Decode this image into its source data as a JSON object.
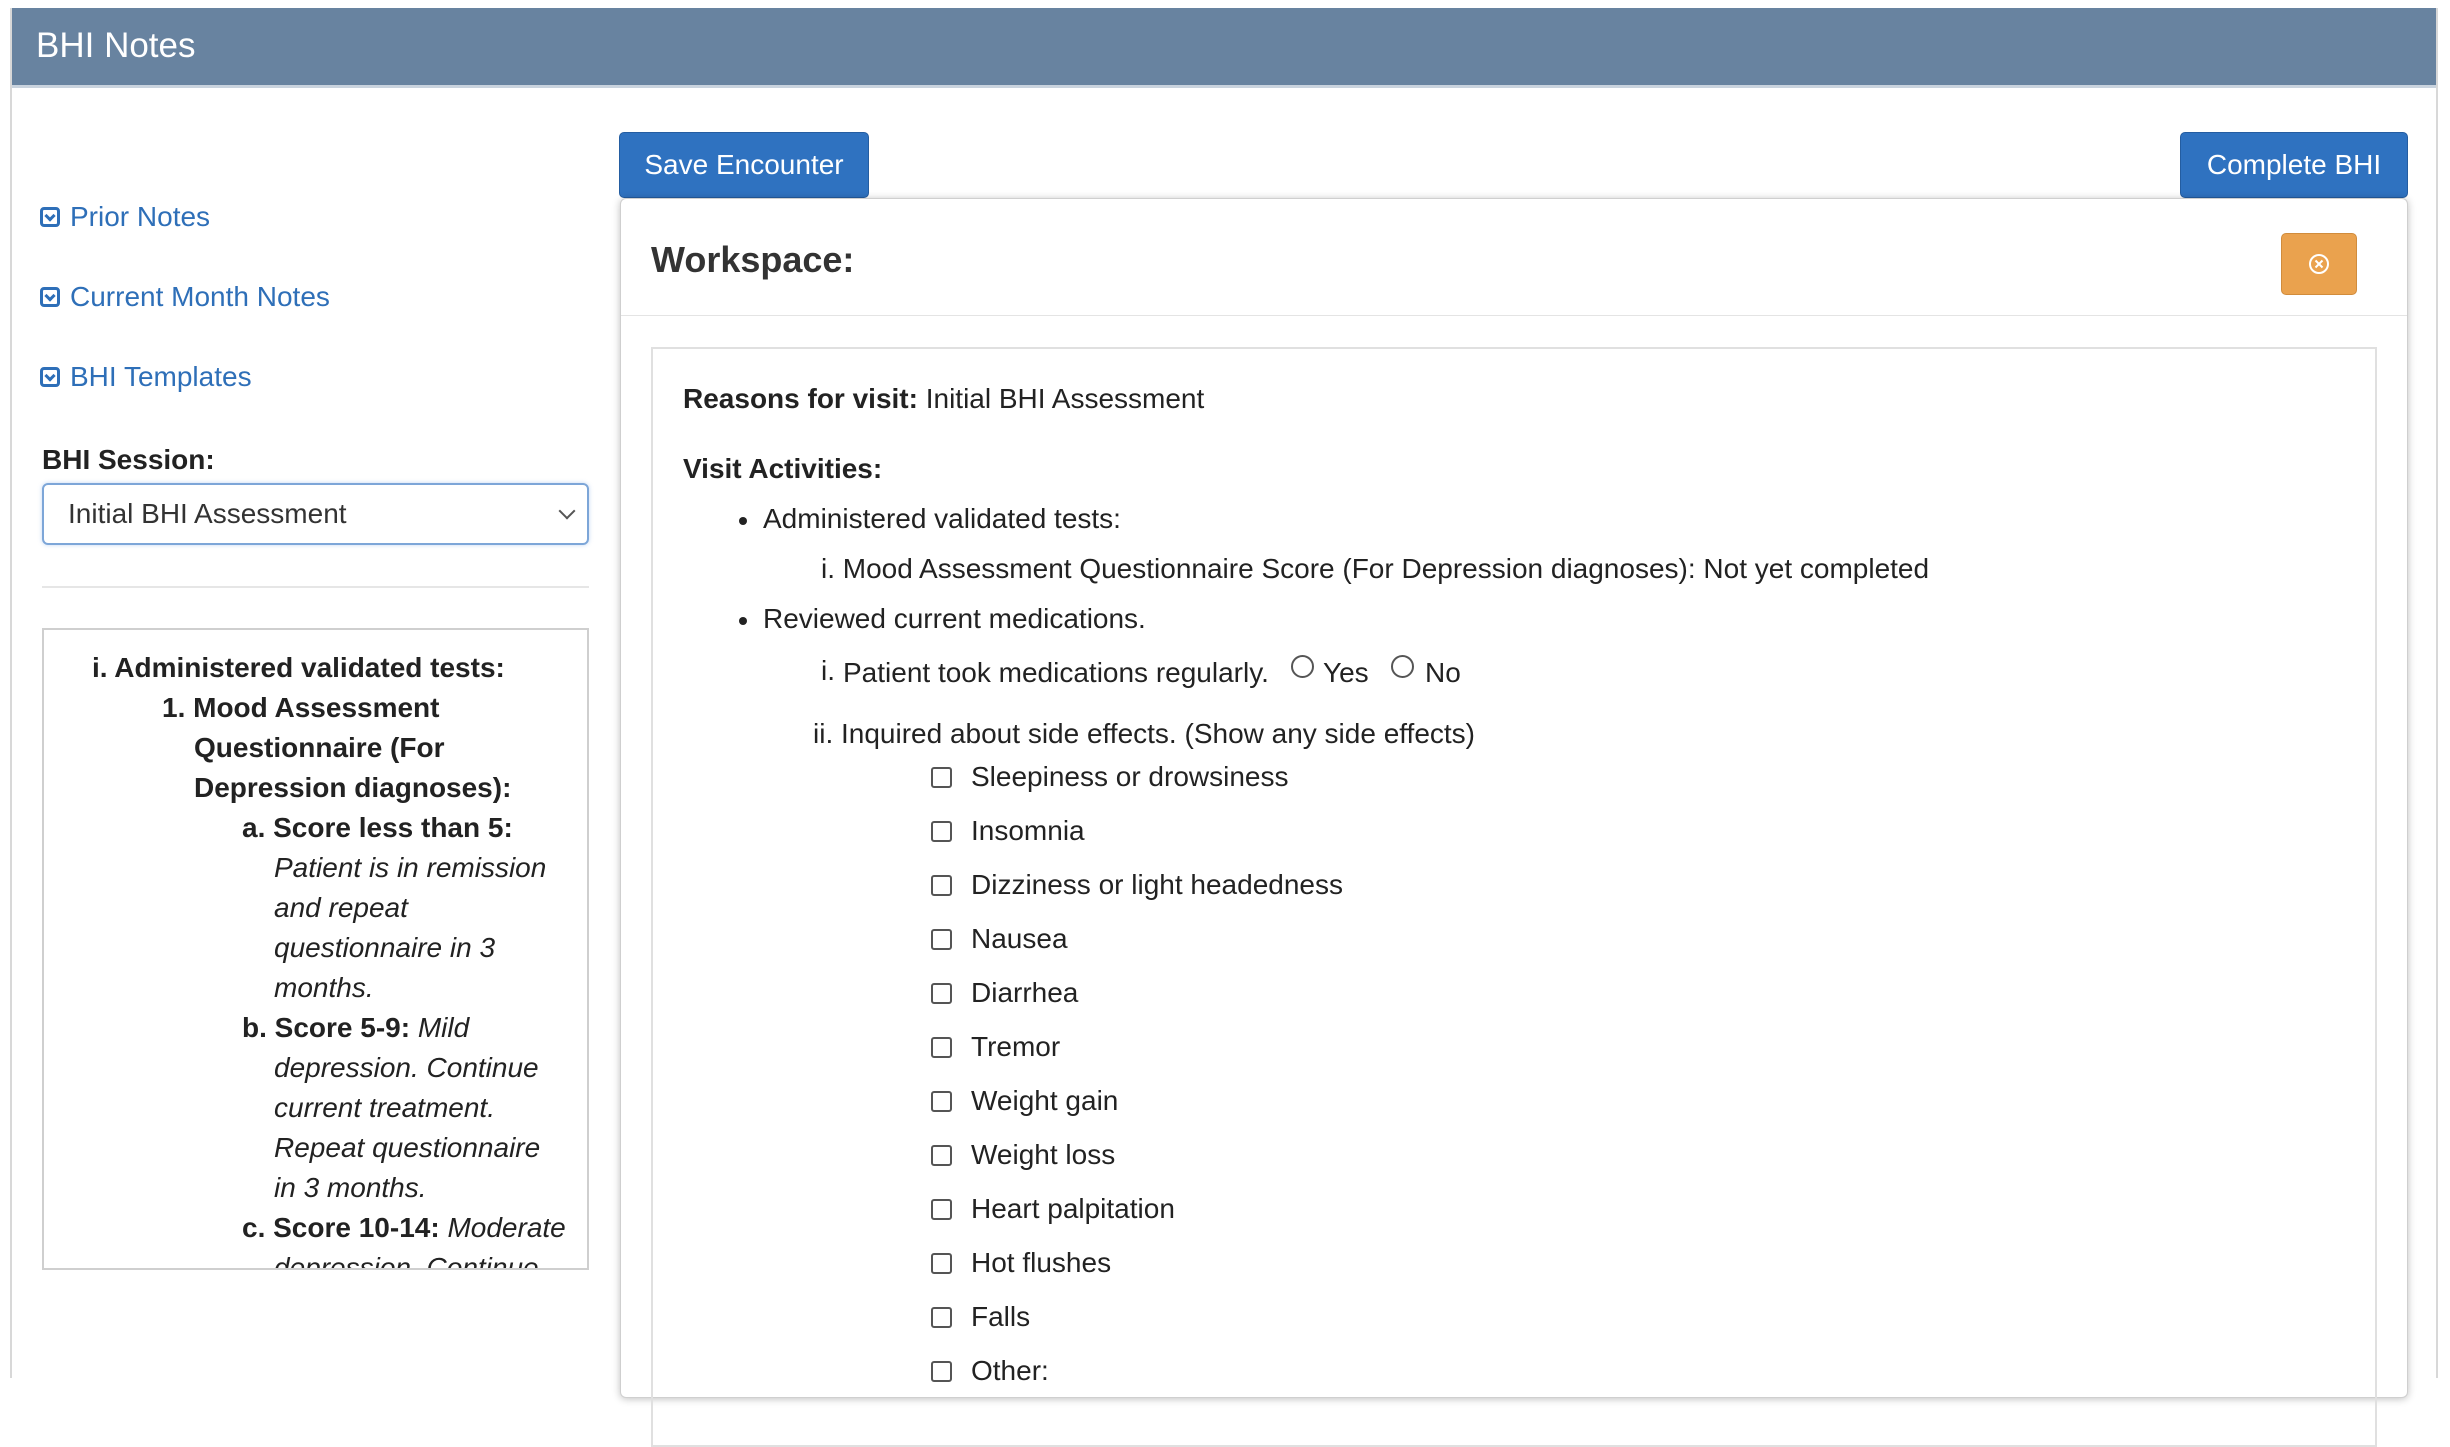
{
  "app": {
    "title": "BHI Notes"
  },
  "toolbar": {
    "save_label": "Save Encounter",
    "complete_label": "Complete BHI"
  },
  "sidebar": {
    "links": [
      {
        "label": "Prior Notes",
        "icon": "chevron-down-square-icon"
      },
      {
        "label": "Current Month Notes",
        "icon": "chevron-down-square-icon"
      },
      {
        "label": "BHI Templates",
        "icon": "chevron-down-square-icon"
      }
    ],
    "session_label": "BHI Session:",
    "session_value": "Initial BHI Assessment"
  },
  "guide": {
    "l1": "i. Administered validated tests:",
    "l2": "1. Mood Assessment",
    "l3": "Questionnaire (For",
    "l4": "Depression diagnoses):",
    "a_label": "a. Score less than 5:",
    "a1": "Patient is in remission",
    "a2": "and repeat",
    "a3": "questionnaire in 3",
    "a4": "months.",
    "b_label": "b. Score 5-9:",
    "b0": "Mild",
    "b1": "depression. Continue",
    "b2": "current treatment.",
    "b3": "Repeat questionnaire",
    "b4": "in 3 months.",
    "c_label": "c. Score 10-14:",
    "c0": "Moderate",
    "c1": "depression. Continue"
  },
  "workspace": {
    "title": "Workspace:",
    "close_icon": "close-circle-icon",
    "reasons_label": "Reasons for visit:",
    "reasons_value": "Initial BHI Assessment",
    "activities_label": "Visit Activities:",
    "activity1": "Administered validated tests:",
    "activity1_sub": "i. Mood Assessment Questionnaire Score (For Depression diagnoses): Not yet completed",
    "activity2": "Reviewed current medications.",
    "med_num": "i.",
    "med_question": "Patient took medications regularly.",
    "yes_label": "Yes",
    "no_label": "No",
    "side_effects_label": "ii. Inquired about side effects. (Show any side effects)",
    "side_effects": [
      "Sleepiness or drowsiness",
      "Insomnia",
      "Dizziness or light headedness",
      "Nausea",
      "Diarrhea",
      "Tremor",
      "Weight gain",
      "Weight loss",
      "Heart palpitation",
      "Hot flushes",
      "Falls",
      "Other:"
    ]
  },
  "colors": {
    "header": "#6883a0",
    "primary": "#2f72c0",
    "link": "#2e6fb8",
    "close_button": "#eaa24e"
  }
}
